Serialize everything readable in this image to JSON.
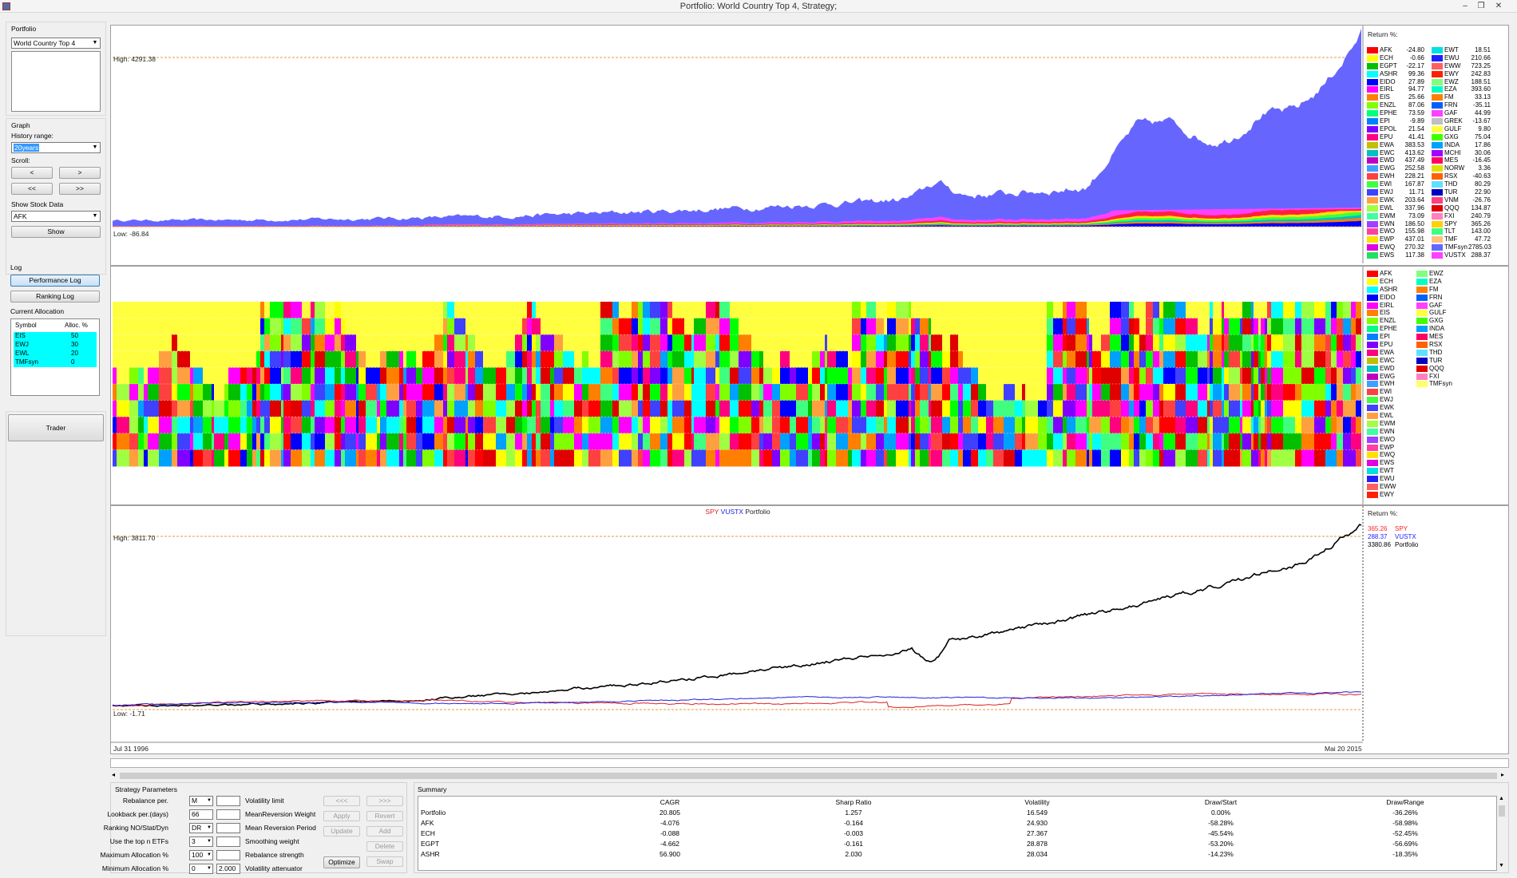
{
  "window": {
    "title": "Portfolio: World Country Top 4, Strategy;",
    "minimize": "–",
    "restore": "❐",
    "close": "✕"
  },
  "left": {
    "portfolio_label": "Portfolio",
    "portfolio_value": "World Country Top 4",
    "graph_label": "Graph",
    "history_label": "History range:",
    "history_value": "20years",
    "scroll_label": "Scroll:",
    "scroll_left": "<",
    "scroll_right": ">",
    "scroll_first": "<<",
    "scroll_last": ">>",
    "show_stock_label": "Show Stock Data",
    "stock_value": "AFK",
    "show_btn": "Show",
    "log_label": "Log",
    "perf_log_btn": "Performance Log",
    "rank_log_btn": "Ranking Log",
    "current_alloc_label": "Current Allocation",
    "alloc_headers": [
      "Symbol",
      "Alloc. %"
    ],
    "alloc_rows": [
      {
        "sym": "EIS",
        "val": "50"
      },
      {
        "sym": "EWJ",
        "val": "30"
      },
      {
        "sym": "EWL",
        "val": "20"
      },
      {
        "sym": "TMFsyn",
        "val": "0"
      }
    ],
    "trader_btn": "Trader"
  },
  "chart1": {
    "high": "High: 4291.38",
    "low": "Low: -86.84",
    "legend_title": "Return %:",
    "legend_col1": [
      {
        "n": "AFK",
        "v": "-24.80",
        "c": "#ff0000"
      },
      {
        "n": "ECH",
        "v": "-0.66",
        "c": "#ffff00"
      },
      {
        "n": "EGPT",
        "v": "-22.17",
        "c": "#00c000"
      },
      {
        "n": "ASHR",
        "v": "99.36",
        "c": "#00ffff"
      },
      {
        "n": "EIDO",
        "v": "27.89",
        "c": "#0000ff"
      },
      {
        "n": "EIRL",
        "v": "94.77",
        "c": "#ff00ff"
      },
      {
        "n": "EIS",
        "v": "25.66",
        "c": "#ff8000"
      },
      {
        "n": "ENZL",
        "v": "87.06",
        "c": "#80ff00"
      },
      {
        "n": "EPHE",
        "v": "73.59",
        "c": "#00ff80"
      },
      {
        "n": "EPI",
        "v": "-9.89",
        "c": "#0080ff"
      },
      {
        "n": "EPOL",
        "v": "21.54",
        "c": "#8000ff"
      },
      {
        "n": "EPU",
        "v": "41.41",
        "c": "#ff0080"
      },
      {
        "n": "EWA",
        "v": "383.53",
        "c": "#c0c000"
      },
      {
        "n": "EWC",
        "v": "413.62",
        "c": "#00c0c0"
      },
      {
        "n": "EWD",
        "v": "437.49",
        "c": "#c000c0"
      },
      {
        "n": "EWG",
        "v": "252.58",
        "c": "#40a0ff"
      },
      {
        "n": "EWH",
        "v": "228.21",
        "c": "#ff4040"
      },
      {
        "n": "EWI",
        "v": "167.87",
        "c": "#40ff40"
      },
      {
        "n": "EWJ",
        "v": "11.71",
        "c": "#4040ff"
      },
      {
        "n": "EWK",
        "v": "203.64",
        "c": "#ffa040"
      },
      {
        "n": "EWL",
        "v": "337.96",
        "c": "#a0ff40"
      },
      {
        "n": "EWM",
        "v": "73.09",
        "c": "#40ffa0"
      },
      {
        "n": "EWN",
        "v": "186.50",
        "c": "#a040ff"
      },
      {
        "n": "EWO",
        "v": "155.98",
        "c": "#ff40a0"
      },
      {
        "n": "EWP",
        "v": "437.01",
        "c": "#ffe000"
      },
      {
        "n": "EWQ",
        "v": "270.32",
        "c": "#e000e0"
      },
      {
        "n": "EWS",
        "v": "117.38",
        "c": "#20e060"
      }
    ],
    "legend_col2": [
      {
        "n": "EWT",
        "v": "18.51",
        "c": "#00e0e0"
      },
      {
        "n": "EWU",
        "v": "210.66",
        "c": "#2020ff"
      },
      {
        "n": "EWW",
        "v": "723.25",
        "c": "#ff6060"
      },
      {
        "n": "EWY",
        "v": "242.83",
        "c": "#ff2000"
      },
      {
        "n": "EWZ",
        "v": "188.51",
        "c": "#80ff80"
      },
      {
        "n": "EZA",
        "v": "393.60",
        "c": "#00ffc0"
      },
      {
        "n": "FM",
        "v": "33.13",
        "c": "#ff8000"
      },
      {
        "n": "FRN",
        "v": "-35.11",
        "c": "#0060ff"
      },
      {
        "n": "GAF",
        "v": "44.99",
        "c": "#ff40ff"
      },
      {
        "n": "GREK",
        "v": "-13.67",
        "c": "#c0c0c0"
      },
      {
        "n": "GULF",
        "v": "9.80",
        "c": "#ffff40"
      },
      {
        "n": "GXG",
        "v": "75.04",
        "c": "#40ff00"
      },
      {
        "n": "INDA",
        "v": "17.86",
        "c": "#00a0ff"
      },
      {
        "n": "MCHI",
        "v": "30.06",
        "c": "#a000ff"
      },
      {
        "n": "MES",
        "v": "-16.45",
        "c": "#ff0060"
      },
      {
        "n": "NORW",
        "v": "3.36",
        "c": "#e0e000"
      },
      {
        "n": "RSX",
        "v": "-40.63",
        "c": "#ff6000"
      },
      {
        "n": "THD",
        "v": "80.29",
        "c": "#60e0ff"
      },
      {
        "n": "TUR",
        "v": "22.90",
        "c": "#0000c0"
      },
      {
        "n": "VNM",
        "v": "-26.76",
        "c": "#ff4080"
      },
      {
        "n": "QQQ",
        "v": "134.87",
        "c": "#e00000"
      },
      {
        "n": "FXI",
        "v": "240.79",
        "c": "#ff80c0"
      },
      {
        "n": "SPY",
        "v": "365.26",
        "c": "#ffd000"
      },
      {
        "n": "TLT",
        "v": "143.00",
        "c": "#40ff80"
      },
      {
        "n": "TMF",
        "v": "47.72",
        "c": "#ffc080"
      },
      {
        "n": "TMFsyn",
        "v": "2785.03",
        "c": "#6666ff"
      },
      {
        "n": "VUSTX",
        "v": "288.37",
        "c": "#ff40ff"
      }
    ]
  },
  "chart2": {
    "legend_col1": [
      {
        "n": "AFK",
        "c": "#ff0000"
      },
      {
        "n": "ECH",
        "c": "#ffff00"
      },
      {
        "n": "ASHR",
        "c": "#00ffff"
      },
      {
        "n": "EIDO",
        "c": "#0000ff"
      },
      {
        "n": "EIRL",
        "c": "#ff00ff"
      },
      {
        "n": "EIS",
        "c": "#ff8000"
      },
      {
        "n": "ENZL",
        "c": "#80ff00"
      },
      {
        "n": "EPHE",
        "c": "#00ff80"
      },
      {
        "n": "EPI",
        "c": "#0080ff"
      },
      {
        "n": "EPU",
        "c": "#8000ff"
      },
      {
        "n": "EWA",
        "c": "#ff0080"
      },
      {
        "n": "EWC",
        "c": "#c0c000"
      },
      {
        "n": "EWD",
        "c": "#00c0c0"
      },
      {
        "n": "EWG",
        "c": "#c000c0"
      },
      {
        "n": "EWH",
        "c": "#40a0ff"
      },
      {
        "n": "EWI",
        "c": "#ff4040"
      },
      {
        "n": "EWJ",
        "c": "#40ff40"
      },
      {
        "n": "EWK",
        "c": "#4040ff"
      },
      {
        "n": "EWL",
        "c": "#ffa040"
      },
      {
        "n": "EWM",
        "c": "#a0ff40"
      },
      {
        "n": "EWN",
        "c": "#40ffa0"
      },
      {
        "n": "EWO",
        "c": "#a040ff"
      },
      {
        "n": "EWP",
        "c": "#ff40a0"
      },
      {
        "n": "EWQ",
        "c": "#ffe000"
      },
      {
        "n": "EWS",
        "c": "#e000e0"
      },
      {
        "n": "EWT",
        "c": "#00e0e0"
      },
      {
        "n": "EWU",
        "c": "#2020ff"
      },
      {
        "n": "EWW",
        "c": "#ff6060"
      },
      {
        "n": "EWY",
        "c": "#ff2000"
      }
    ],
    "legend_col2": [
      {
        "n": "EWZ",
        "c": "#80ff80"
      },
      {
        "n": "EZA",
        "c": "#00ffc0"
      },
      {
        "n": "FM",
        "c": "#ff8000"
      },
      {
        "n": "FRN",
        "c": "#0060ff"
      },
      {
        "n": "GAF",
        "c": "#ff40ff"
      },
      {
        "n": "GULF",
        "c": "#ffff40"
      },
      {
        "n": "GXG",
        "c": "#40ff00"
      },
      {
        "n": "INDA",
        "c": "#00a0ff"
      },
      {
        "n": "MES",
        "c": "#ff0060"
      },
      {
        "n": "RSX",
        "c": "#ff6000"
      },
      {
        "n": "THD",
        "c": "#60e0ff"
      },
      {
        "n": "TUR",
        "c": "#0000c0"
      },
      {
        "n": "QQQ",
        "c": "#e00000"
      },
      {
        "n": "FXI",
        "c": "#ff80c0"
      },
      {
        "n": "TMFsyn",
        "c": "#ffff66"
      }
    ],
    "palette": [
      "#ff0000",
      "#ffff00",
      "#00ff00",
      "#0000ff",
      "#ff00ff",
      "#ff8000",
      "#00ffff",
      "#8000ff",
      "#ff0080",
      "#80ff00",
      "#00c000",
      "#ff4040",
      "#4040ff",
      "#ffa040",
      "#40ff80",
      "#e00000",
      "#a0ff40",
      "#00a0ff"
    ]
  },
  "chart3": {
    "title_spy": "SPY",
    "title_vustx": "VUSTX",
    "title_portfolio": "Portfolio",
    "high": "High: 3811.70",
    "low": "Low: -1.71",
    "legend_title": "Return %:",
    "legend": [
      {
        "v": "365.26",
        "n": "SPY",
        "c": "#ff2020"
      },
      {
        "v": "288.37",
        "n": "VUSTX",
        "c": "#2020ff"
      },
      {
        "v": "3380.86",
        "n": "Portfolio",
        "c": "#000000"
      }
    ],
    "date_start": "Jul 31 1996",
    "date_end": "Mai 20 2015"
  },
  "params": {
    "header": "Strategy Parameters",
    "rows": [
      {
        "label": "Rebalance per.",
        "value": "M",
        "combo": true,
        "label2": "Volatility limit",
        "value2": ""
      },
      {
        "label": "Lookback per.(days)",
        "value": "66",
        "combo": false,
        "label2": "MeanReversion Weight",
        "value2": ""
      },
      {
        "label": "Ranking NO/Stat/Dyn",
        "value": "DR",
        "combo": true,
        "label2": "Mean Reversion Period",
        "value2": ""
      },
      {
        "label": "Use the top n ETFs",
        "value": "3",
        "combo": true,
        "label2": "Smoothing  weight",
        "value2": ""
      },
      {
        "label": "Maximum Allocation %",
        "value": "100",
        "combo": true,
        "label2": "Rebalance strength",
        "value2": ""
      },
      {
        "label": "Minimum Allocation %",
        "value": "0",
        "combo": true,
        "label2": "Volatility attenuator",
        "value2": "2.000"
      }
    ],
    "btn_prev": "<<<",
    "btn_next": ">>>",
    "btn_apply": "Apply",
    "btn_revert": "Revert",
    "btn_update": "Update",
    "btn_add": "Add",
    "btn_delete": "Delete",
    "btn_optimize": "Optimize",
    "btn_swap": "Swap"
  },
  "summary": {
    "header": "Summary",
    "columns": [
      "",
      "CAGR",
      "Sharp Ratio",
      "Volatility",
      "Draw/Start",
      "Draw/Range"
    ],
    "rows": [
      [
        "Portfolio",
        "20.805",
        "1.257",
        "16.549",
        "0.00%",
        "-36.26%"
      ],
      [
        "AFK",
        "-4.076",
        "-0.164",
        "24.930",
        "-58.28%",
        "-58.98%"
      ],
      [
        "ECH",
        "-0.088",
        "-0.003",
        "27.367",
        "-45.54%",
        "-52.45%"
      ],
      [
        "EGPT",
        "-4.662",
        "-0.161",
        "28.878",
        "-53.20%",
        "-56.69%"
      ],
      [
        "ASHR",
        "56.900",
        "2.030",
        "28.034",
        "-14.23%",
        "-18.35%"
      ]
    ],
    "scroll_up": "▲",
    "scroll_down": "▼"
  }
}
